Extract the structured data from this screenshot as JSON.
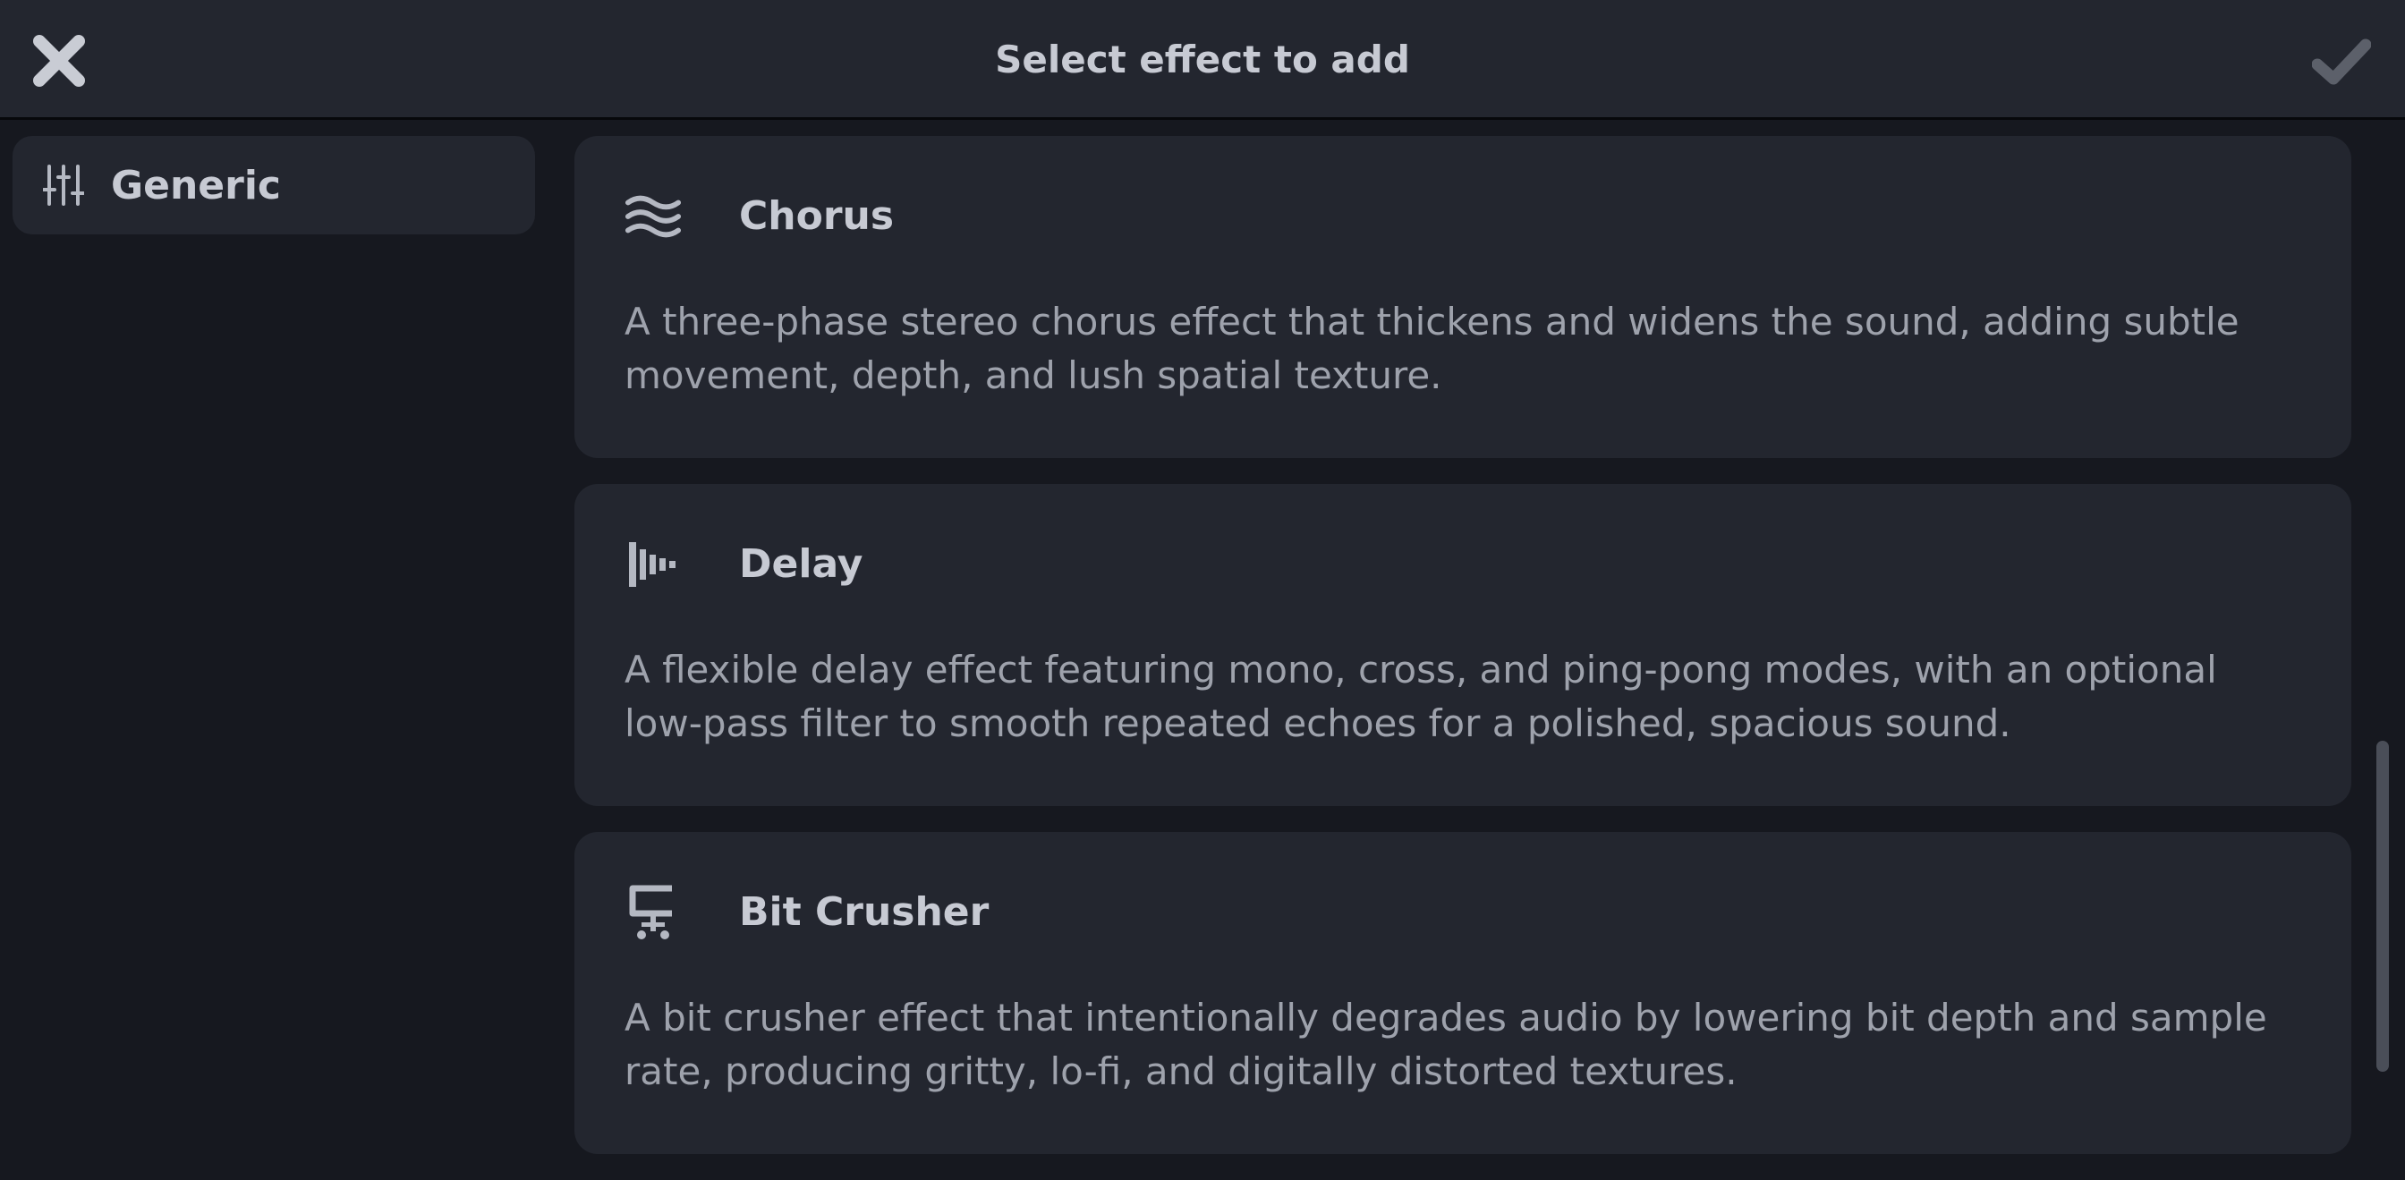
{
  "header": {
    "title": "Select effect to add",
    "close_icon": "close-x-icon",
    "confirm_icon": "checkmark-icon"
  },
  "sidebar": {
    "items": [
      {
        "label": "Generic",
        "icon": "sliders-icon",
        "selected": true
      }
    ]
  },
  "effects": [
    {
      "title": "Chorus",
      "icon": "waves-icon",
      "description": "A three-phase stereo chorus effect that thickens and widens the sound, adding subtle movement, depth, and lush spatial texture."
    },
    {
      "title": "Delay",
      "icon": "delay-bars-icon",
      "description": "A flexible delay effect featuring mono, cross, and ping-pong modes, with an optional low-pass filter to smooth repeated echoes for a polished, spacious sound."
    },
    {
      "title": "Bit Crusher",
      "icon": "clamp-icon",
      "description": "A bit crusher effect that intentionally degrades audio by lowering bit depth and sample rate, producing gritty, lo-fi, and digitally distorted textures."
    }
  ],
  "colors": {
    "background": "#16181f",
    "panel": "#23262f",
    "text": "#c7cad3",
    "muted_text": "#9ea2ac",
    "icon": "#b4b8c2"
  }
}
